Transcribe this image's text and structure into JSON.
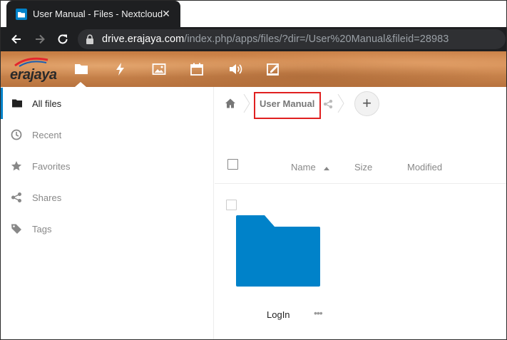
{
  "browser": {
    "tab_title": "User Manual - Files - Nextcloud",
    "close_glyph": "✕",
    "new_tab_glyph": "+",
    "url_host": "drive.erajaya.com",
    "url_path": "/index.php/apps/files/?dir=/User%20Manual&fileid=28983"
  },
  "header": {
    "logo_text": "erajaya",
    "apps": [
      "files-icon",
      "activity-icon",
      "gallery-icon",
      "calendar-icon",
      "audio-icon",
      "notes-icon"
    ],
    "brand_color": "#c77d43"
  },
  "sidebar": {
    "items": [
      {
        "label": "All files",
        "icon": "folder-icon"
      },
      {
        "label": "Recent",
        "icon": "clock-icon"
      },
      {
        "label": "Favorites",
        "icon": "star-icon"
      },
      {
        "label": "Shares",
        "icon": "share-icon"
      },
      {
        "label": "Tags",
        "icon": "tag-icon"
      }
    ],
    "active_color": "#0082c9"
  },
  "main": {
    "breadcrumb": {
      "current": "User Manual"
    },
    "add_glyph": "+",
    "columns": {
      "name": "Name",
      "size": "Size",
      "modified": "Modified"
    },
    "files": [
      {
        "name": "LogIn",
        "type": "folder",
        "color": "#0082c9",
        "more": "•••"
      }
    ]
  }
}
